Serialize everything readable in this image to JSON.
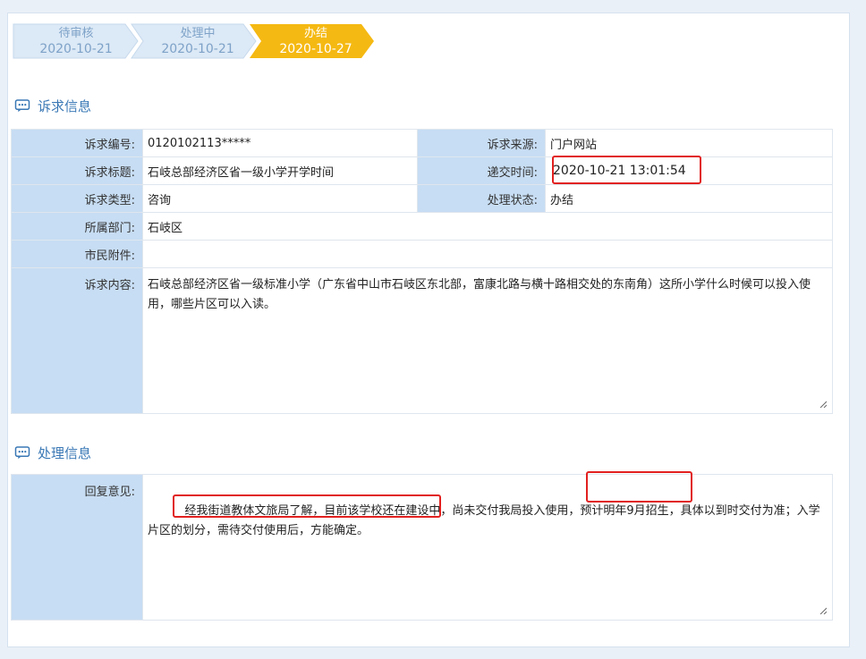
{
  "steps": [
    {
      "name": "待审核",
      "date": "2020-10-21",
      "state": "done"
    },
    {
      "name": "处理中",
      "date": "2020-10-21",
      "state": "done"
    },
    {
      "name": "办结",
      "date": "2020-10-27",
      "state": "active"
    }
  ],
  "sections": {
    "request_title": "诉求信息",
    "process_title": "处理信息"
  },
  "request": {
    "id_label": "诉求编号:",
    "id_value": "0120102113*****",
    "source_label": "诉求来源:",
    "source_value": "门户网站",
    "title_label": "诉求标题:",
    "title_value": "石岐总部经济区省一级小学开学时间",
    "submit_label": "递交时间:",
    "submit_value": "2020-10-21 13:01:54",
    "type_label": "诉求类型:",
    "type_value": "咨询",
    "status_label": "处理状态:",
    "status_value": "办结",
    "dept_label": "所属部门:",
    "dept_value": "石岐区",
    "attach_label": "市民附件:",
    "attach_value": "",
    "content_label": "诉求内容:",
    "content_value": "石岐总部经济区省一级标准小学（广东省中山市石岐区东北部，富康北路与横十路相交处的东南角）这所小学什么时候可以投入使用，哪些片区可以入读。"
  },
  "process": {
    "reply_label": "回复意见:",
    "reply_value": "  经我街道教体文旅局了解，目前该学校还在建设中，尚未交付我局投入使用，预计明年9月招生，具体以到时交付为准；入学片区的划分，需待交付使用后，方能确定。"
  },
  "colors": {
    "accent": "#3a78b5",
    "active_step": "#f5b913",
    "pending_step": "#dce9f6",
    "label_bg": "#c7ddf3",
    "highlight": "#e1201f"
  }
}
